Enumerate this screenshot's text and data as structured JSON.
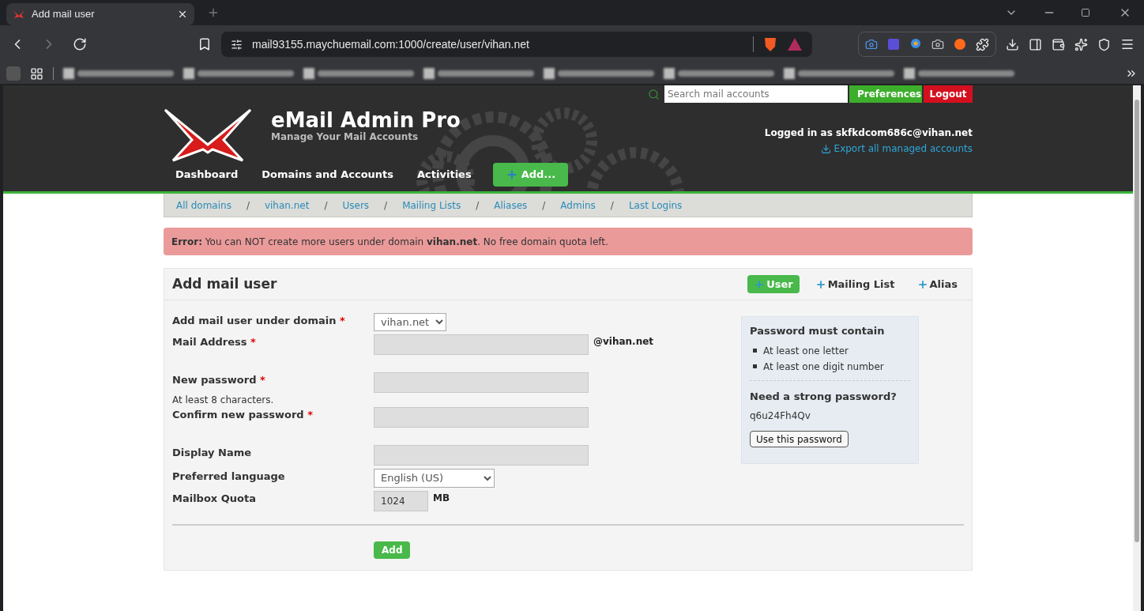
{
  "browser": {
    "tab_title": "Add mail user",
    "url": "mail93155.maychuemail.com:1000/create/user/vihan.net"
  },
  "header": {
    "title": "eMail Admin Pro",
    "subtitle": "Manage Your Mail Accounts",
    "search_placeholder": "Search mail accounts",
    "preferences": "Preferences",
    "logout": "Logout",
    "logged_in": "Logged in as skfkdcom686c@vihan.net",
    "export": "Export all managed accounts",
    "nav": [
      {
        "label": "Dashboard",
        "kind": "link"
      },
      {
        "label": "Domains and Accounts",
        "kind": "link"
      },
      {
        "label": "Activities",
        "kind": "link"
      },
      {
        "label": "Add...",
        "kind": "add"
      }
    ]
  },
  "breadcrumbs": {
    "separator": "/",
    "items": [
      "All domains",
      "vihan.net",
      "Users",
      "Mailing Lists",
      "Aliases",
      "Admins",
      "Last Logins"
    ]
  },
  "error": "**Error:** You can NOT create more users under domain **vihan.net**. No free domain quota left.",
  "panel": {
    "title": "Add mail user",
    "actions": [
      {
        "label": "User",
        "selected": true
      },
      {
        "label": "Mailing List",
        "selected": false
      },
      {
        "label": "Alias",
        "selected": false
      }
    ],
    "fields": [
      {
        "label": "Add mail user under domain",
        "required": true,
        "kind": "select",
        "value": "vihan.net"
      },
      {
        "label": "Mail Address",
        "required": true,
        "kind": "text",
        "suffix": "@vihan.net"
      },
      {
        "label": "New password",
        "required": true,
        "kind": "text",
        "hint": "At least 8 characters."
      },
      {
        "label": "Confirm new password",
        "required": true,
        "kind": "text"
      },
      {
        "label": "Display Name",
        "required": false,
        "kind": "text"
      },
      {
        "label": "Preferred language",
        "required": false,
        "kind": "wideselect",
        "value": "English (US)"
      },
      {
        "label": "Mailbox Quota",
        "required": false,
        "kind": "quota",
        "value": "1024",
        "suffix": "MB"
      }
    ],
    "required_mark": "*",
    "submit": "Add",
    "help": {
      "title": "Password must contain",
      "rules": [
        "At least one letter",
        "At least one digit number"
      ],
      "strong_title": "Need a strong password?",
      "suggestion": "q6u24Fh4Qv",
      "use_button": "Use this password"
    }
  }
}
